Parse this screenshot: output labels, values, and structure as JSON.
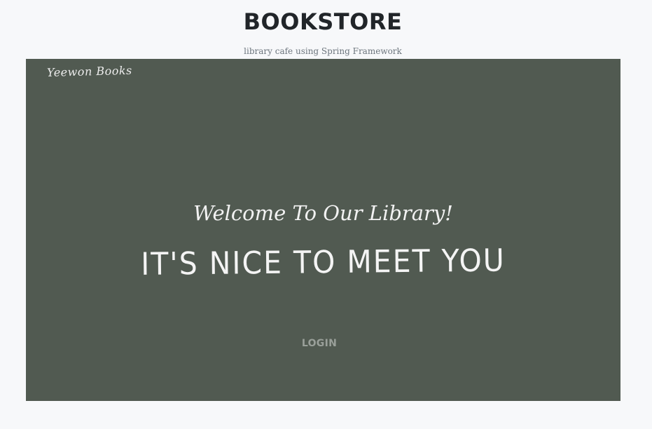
{
  "header": {
    "title": "BOOKSTORE",
    "subtitle": "library cafe using Spring Framework"
  },
  "hero": {
    "background_color": "#515a51",
    "brand": "Yeewon Books",
    "welcome": "Welcome To Our Library!",
    "headline": "IT'S NICE TO MEET YOU",
    "login_label": "LOGIN"
  }
}
